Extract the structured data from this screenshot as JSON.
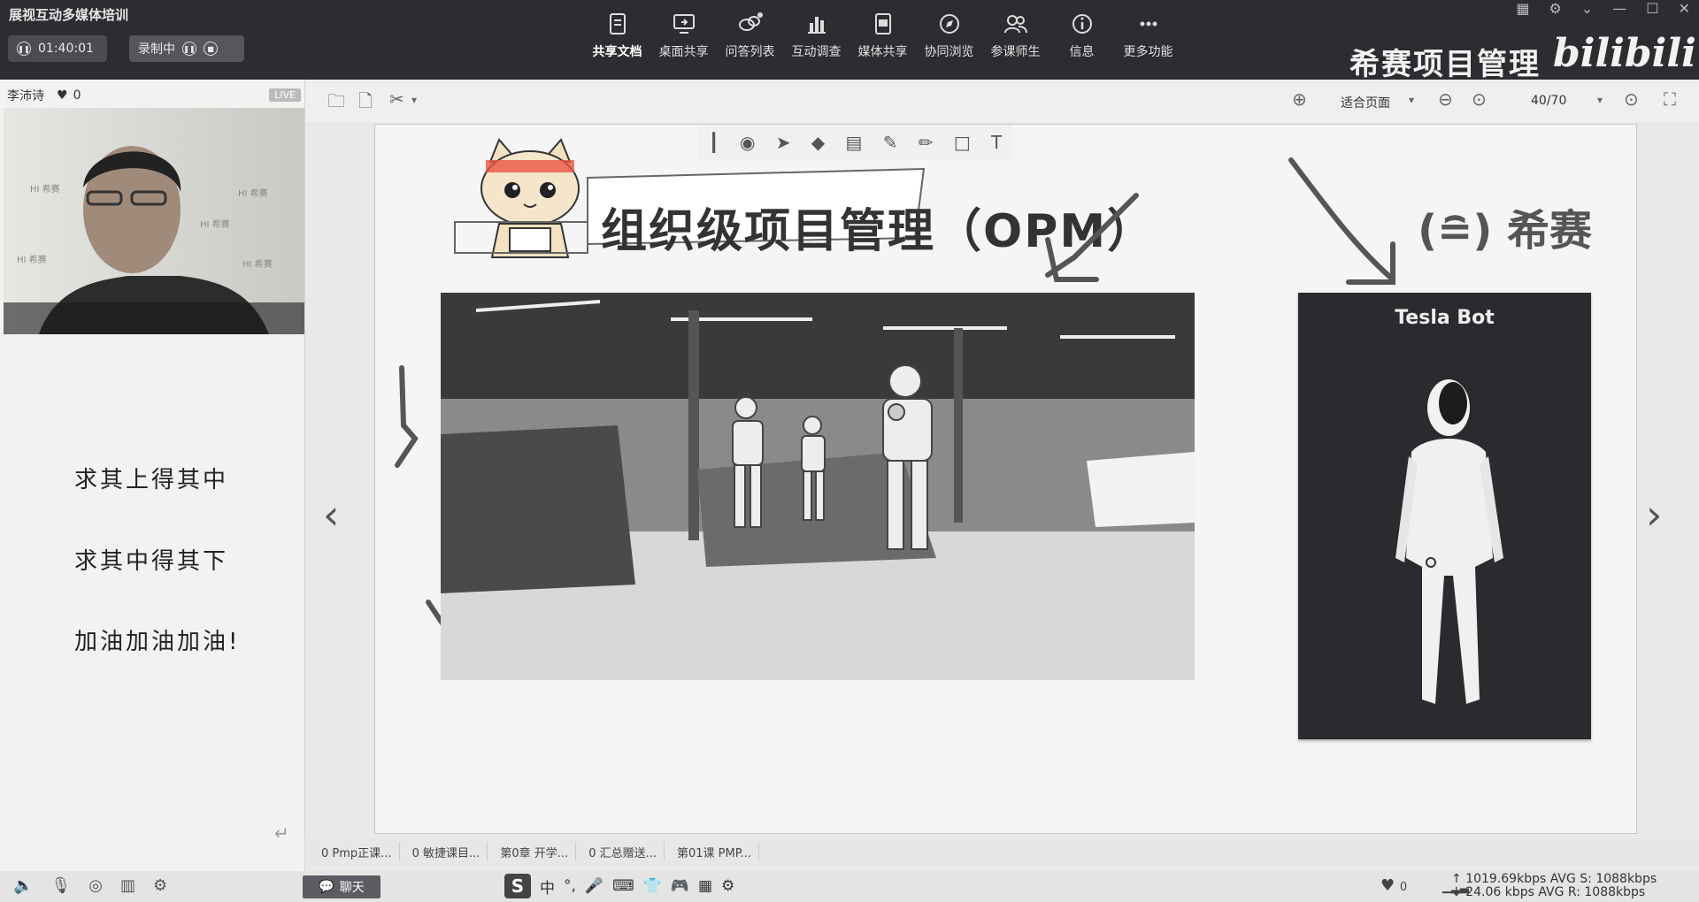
{
  "app": {
    "title": "展视互动多媒体培训",
    "timer": "01:40:01",
    "recording": "录制中"
  },
  "toolbar": [
    {
      "label": "共享文档",
      "icon": "doc-share-icon"
    },
    {
      "label": "桌面共享",
      "icon": "screen-share-icon"
    },
    {
      "label": "问答列表",
      "icon": "qa-icon"
    },
    {
      "label": "互动调查",
      "icon": "survey-icon"
    },
    {
      "label": "媒体共享",
      "icon": "media-icon"
    },
    {
      "label": "协同浏览",
      "icon": "browse-icon"
    },
    {
      "label": "参课师生",
      "icon": "users-icon"
    },
    {
      "label": "信息",
      "icon": "info-icon"
    },
    {
      "label": "更多功能",
      "icon": "more-icon"
    }
  ],
  "brand": {
    "text": "希赛项目管理",
    "logo": "bilibili"
  },
  "presenter": {
    "name": "李沛诗",
    "likes": "0",
    "badge": "LIVE"
  },
  "motto": [
    "求其上得其中",
    "求其中得其下",
    "加油加油加油!"
  ],
  "doc": {
    "fit": "适合页面",
    "page": "40/70"
  },
  "slide": {
    "title": "组织级项目管理（OPM）",
    "logo": "希赛",
    "card_title": "Tesla Bot"
  },
  "tabs": [
    "0 Pmp正课...",
    "0 敏捷课目...",
    "第0章 开学...",
    "0 汇总赠送...",
    "第01课 PMP..."
  ],
  "status": {
    "chat": "聊天",
    "likes": "0",
    "net_up": "1019.69kbps",
    "net_down": "24.06 kbps",
    "avg_s": "AVG S: 1088kbps",
    "avg_r": "AVG R: 1088kbps"
  },
  "ime": [
    "中",
    "°,",
    "🎤",
    "⌨",
    "👕",
    "🎮",
    "▦",
    "⚙"
  ]
}
